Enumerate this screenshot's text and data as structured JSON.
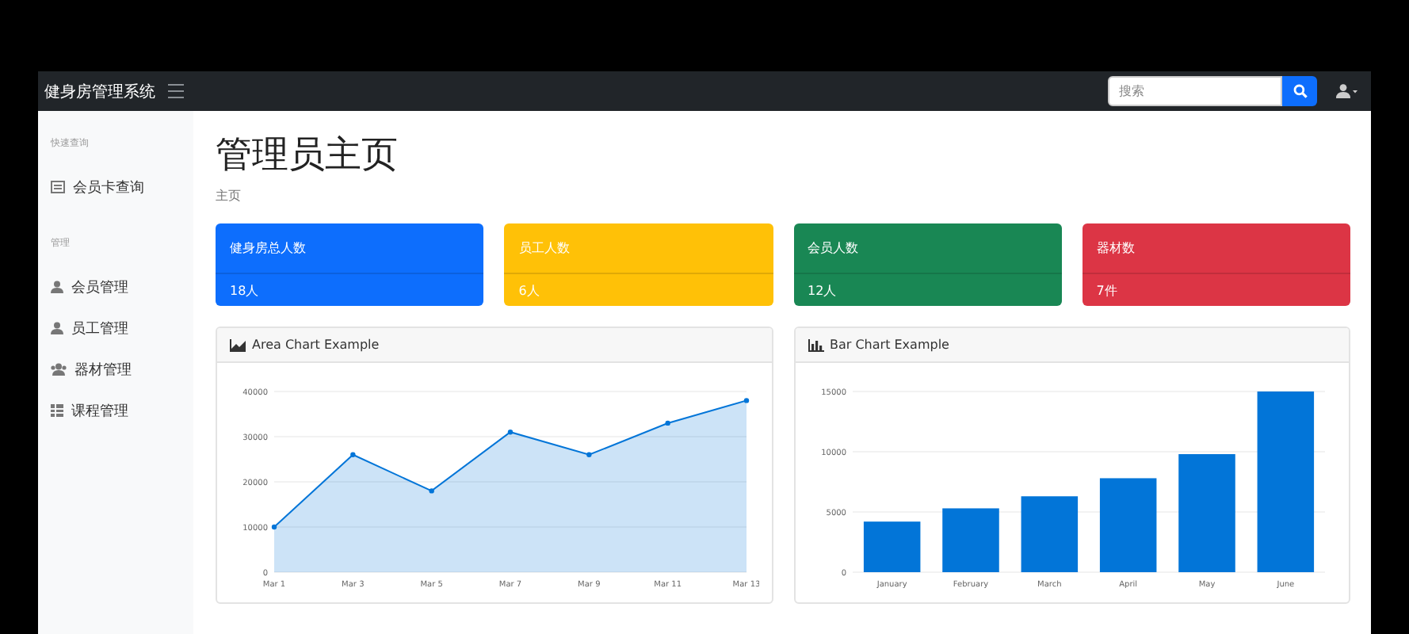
{
  "navbar": {
    "brand": "健身房管理系统",
    "search": {
      "placeholder": "搜索"
    }
  },
  "sidebar": {
    "sections": [
      {
        "heading": "快速查询",
        "items": [
          {
            "label": "会员卡查询"
          }
        ]
      },
      {
        "heading": "管理",
        "items": [
          {
            "label": "会员管理"
          },
          {
            "label": "员工管理"
          },
          {
            "label": "器材管理"
          },
          {
            "label": "课程管理"
          }
        ]
      }
    ]
  },
  "page": {
    "title": "管理员主页",
    "breadcrumb": "主页"
  },
  "stat_cards": [
    {
      "label": "健身房总人数",
      "value": "18人",
      "color": "#0d6efd"
    },
    {
      "label": "员工人数",
      "value": "6人",
      "color": "#ffc107"
    },
    {
      "label": "会员人数",
      "value": "12人",
      "color": "#198754"
    },
    {
      "label": "器材数",
      "value": "7件",
      "color": "#dc3545"
    }
  ],
  "charts": [
    {
      "title": "Area Chart Example",
      "chart_data": {
        "type": "area",
        "x": [
          "Mar 1",
          "Mar 3",
          "Mar 5",
          "Mar 7",
          "Mar 9",
          "Mar 11",
          "Mar 13"
        ],
        "series": [
          {
            "color": "#0275d8",
            "values": [
              10000,
              26000,
              18000,
              31000,
              26000,
              33000,
              38000
            ]
          }
        ],
        "ylim": [
          0,
          40000
        ],
        "yticks": [
          0,
          10000,
          20000,
          30000,
          40000
        ],
        "grid": true
      }
    },
    {
      "title": "Bar Chart Example",
      "chart_data": {
        "type": "bar",
        "categories": [
          "January",
          "February",
          "March",
          "April",
          "May",
          "June"
        ],
        "series": [
          {
            "color": "#0275d8",
            "values": [
              4200,
              5300,
              6300,
              7800,
              9800,
              15000
            ]
          }
        ],
        "ylim": [
          0,
          15000
        ],
        "yticks": [
          0,
          5000,
          10000,
          15000
        ],
        "grid": true
      }
    }
  ]
}
